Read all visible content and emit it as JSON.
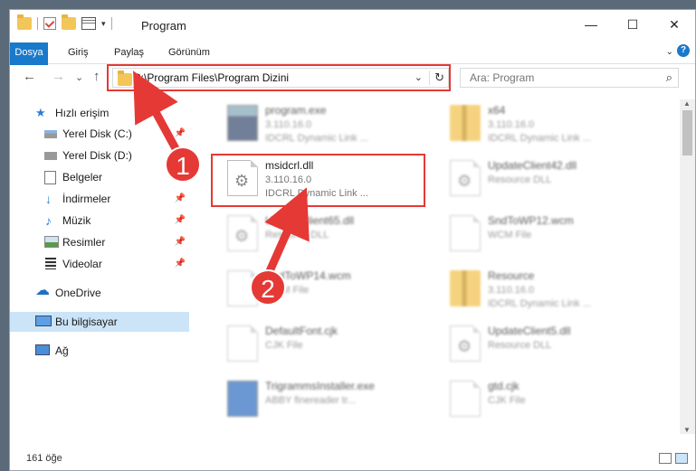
{
  "window": {
    "title": "Program",
    "minimize": "—",
    "maximize": "☐",
    "close": "✕"
  },
  "ribbon": {
    "tabs": [
      "Dosya",
      "Giriş",
      "Paylaş",
      "Görünüm"
    ],
    "expand": "⌄",
    "help": "?"
  },
  "nav": {
    "back": "←",
    "forward": "→",
    "recent": "⌄",
    "up": "↑",
    "address": "C:\\Program Files\\Program Dizini",
    "address_dropdown": "⌄",
    "refresh": "↻",
    "search_placeholder": "Ara: Program",
    "search_icon": "⌕"
  },
  "sidebar": {
    "items": [
      {
        "label": "Hızlı erişim",
        "icon": "star-icon"
      },
      {
        "label": "Yerel Disk (C:)",
        "icon": "drive-icon"
      },
      {
        "label": "Yerel Disk (D:)",
        "icon": "drive-icon"
      },
      {
        "label": "Belgeler",
        "icon": "documents-icon"
      },
      {
        "label": "İndirmeler",
        "icon": "download-icon"
      },
      {
        "label": "Müzik",
        "icon": "music-icon"
      },
      {
        "label": "Resimler",
        "icon": "pictures-icon"
      },
      {
        "label": "Videolar",
        "icon": "video-icon"
      },
      {
        "label": "OneDrive",
        "icon": "cloud-icon"
      },
      {
        "label": "Bu bilgisayar",
        "icon": "computer-icon"
      },
      {
        "label": "Ağ",
        "icon": "network-icon"
      }
    ],
    "pin": "📌"
  },
  "files": [
    {
      "name": "program.exe",
      "version": "3.110.16.0",
      "desc": "IDCRL Dynamic Link ..."
    },
    {
      "name": "x64",
      "version": "3.110.16.0",
      "desc": "IDCRL Dynamic Link ..."
    },
    {
      "name": "msidcrl.dll",
      "version": "3.110.16.0",
      "desc": "IDCRL Dynamic Link ..."
    },
    {
      "name": "UpdateClient42.dll",
      "version": "Resource DLL",
      "desc": ""
    },
    {
      "name": "UpdateClient65.dll",
      "version": "Resource DLL",
      "desc": ""
    },
    {
      "name": "SndToWP12.wcm",
      "version": "WCM File",
      "desc": ""
    },
    {
      "name": "SndToWP14.wcm",
      "version": "WCM File",
      "desc": ""
    },
    {
      "name": "Resource",
      "version": "3.110.16.0",
      "desc": "IDCRL Dynamic Link ..."
    },
    {
      "name": "DefaultFont.cjk",
      "version": "CJK File",
      "desc": ""
    },
    {
      "name": "UpdateClient5.dll",
      "version": "Resource DLL",
      "desc": ""
    },
    {
      "name": "TrigrammsInstaller.exe",
      "version": "ABBY finereader tr...",
      "desc": ""
    },
    {
      "name": "gtd.cjk",
      "version": "CJK File",
      "desc": ""
    }
  ],
  "status": {
    "count": "161 öğe"
  },
  "annotations": {
    "step1": "1",
    "step2": "2",
    "accent": "#e53935"
  }
}
